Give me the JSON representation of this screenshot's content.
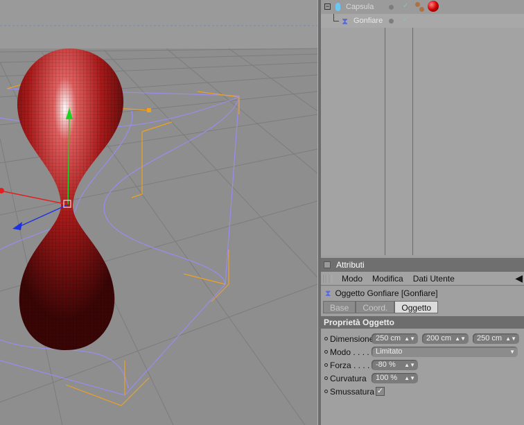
{
  "object_manager": {
    "objects": [
      {
        "name": "Capsula",
        "icon": "capsule-icon"
      },
      {
        "name": "Gonfiare",
        "icon": "bulge-deformer-icon"
      }
    ]
  },
  "attributes": {
    "panel_title": "Attributi",
    "menu": [
      "Modo",
      "Modifica",
      "Dati Utente"
    ],
    "object_title": "Oggetto Gonfiare [Gonfiare]",
    "tabs": [
      {
        "label": "Base",
        "active": false
      },
      {
        "label": "Coord.",
        "active": false
      },
      {
        "label": "Oggetto",
        "active": true
      }
    ],
    "section": "Proprietà Oggetto",
    "props": {
      "dimensione": {
        "label": "Dimensione",
        "x": "250 cm",
        "y": "200 cm",
        "z": "250 cm"
      },
      "modo": {
        "label": "Modo . . . .",
        "value": "Limitato"
      },
      "forza": {
        "label": "Forza . . . .",
        "value": "-80 %"
      },
      "curvatura": {
        "label": "Curvatura",
        "value": "100 %"
      },
      "smussatura": {
        "label": "Smussatura",
        "checked": true
      }
    }
  },
  "colors": {
    "object": "#b01818",
    "cage": "#9a8cf0",
    "bbox": "#f0a020"
  }
}
